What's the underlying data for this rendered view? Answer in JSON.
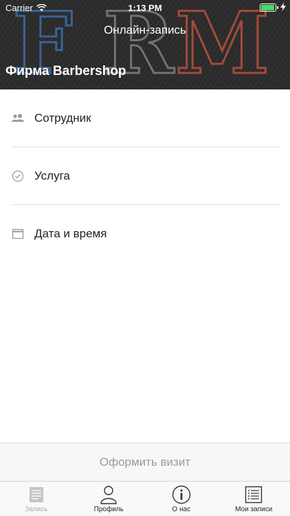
{
  "status_bar": {
    "carrier": "Carrier",
    "time": "1:13 PM"
  },
  "header": {
    "nav_title": "Онлайн-запись",
    "company": "Фирма Barbershop",
    "logo_letters": [
      "F",
      "R",
      "M"
    ]
  },
  "list": [
    {
      "label": "Сотрудник",
      "icon": "people-icon"
    },
    {
      "label": "Услуга",
      "icon": "check-circle-icon"
    },
    {
      "label": "Дата и время",
      "icon": "calendar-icon"
    }
  ],
  "action": {
    "label": "Оформить визит"
  },
  "tabs": [
    {
      "label": "Запись",
      "icon": "document-icon",
      "active": true
    },
    {
      "label": "Профиль",
      "icon": "person-icon",
      "active": false
    },
    {
      "label": "О нас",
      "icon": "info-icon",
      "active": false
    },
    {
      "label": "Мои записи",
      "icon": "list-icon",
      "active": false
    }
  ],
  "colors": {
    "header_bg": "#2a2a2a",
    "accent_blue": "#3b6ea8",
    "accent_red": "#b8503f",
    "battery": "#4cd964"
  }
}
